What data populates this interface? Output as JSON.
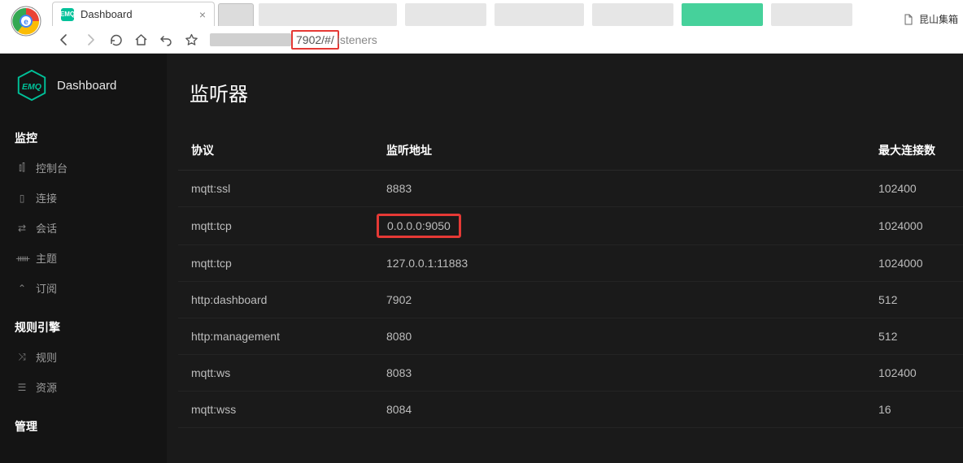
{
  "browser": {
    "active_tab_title": "Dashboard",
    "url_highlighted": "7902/#/",
    "url_after": "isteners",
    "other_tab_label": "昆山集箱"
  },
  "sidebar": {
    "brand": "Dashboard",
    "sections": [
      {
        "title": "监控",
        "items": [
          {
            "label": "控制台"
          },
          {
            "label": "连接"
          },
          {
            "label": "会话"
          },
          {
            "label": "主题"
          },
          {
            "label": "订阅"
          }
        ]
      },
      {
        "title": "规则引擎",
        "items": [
          {
            "label": "规则"
          },
          {
            "label": "资源"
          }
        ]
      },
      {
        "title": "管理",
        "items": []
      }
    ]
  },
  "page": {
    "title": "监听器",
    "columns": {
      "protocol": "协议",
      "address": "监听地址",
      "max_conn": "最大连接数"
    },
    "rows": [
      {
        "protocol": "mqtt:ssl",
        "address": "8883",
        "max_conn": "102400",
        "highlight": false
      },
      {
        "protocol": "mqtt:tcp",
        "address": "0.0.0.0:9050",
        "max_conn": "1024000",
        "highlight": true
      },
      {
        "protocol": "mqtt:tcp",
        "address": "127.0.0.1:11883",
        "max_conn": "1024000",
        "highlight": false
      },
      {
        "protocol": "http:dashboard",
        "address": "7902",
        "max_conn": "512",
        "highlight": false
      },
      {
        "protocol": "http:management",
        "address": "8080",
        "max_conn": "512",
        "highlight": false
      },
      {
        "protocol": "mqtt:ws",
        "address": "8083",
        "max_conn": "102400",
        "highlight": false
      },
      {
        "protocol": "mqtt:wss",
        "address": "8084",
        "max_conn": "16",
        "highlight": false
      }
    ]
  },
  "colors": {
    "highlight_border": "#e53935",
    "brand_green": "#00c199"
  }
}
